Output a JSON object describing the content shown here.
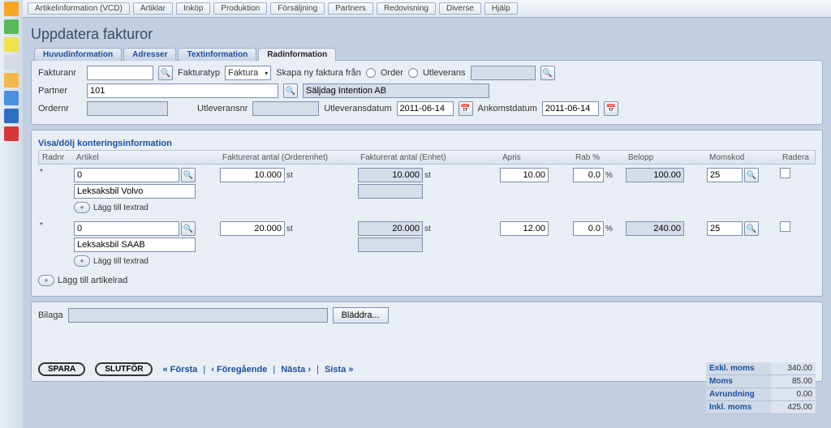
{
  "topmenu": {
    "items": [
      "Artikelinformation (VCD)",
      "Artiklar",
      "Inköp",
      "Produktion",
      "Försäljning",
      "Partners",
      "Redovisning",
      "Diverse",
      "Hjälp"
    ]
  },
  "page": {
    "title": "Uppdatera fakturor"
  },
  "tabs": [
    "Huvudinformation",
    "Adresser",
    "Textinformation",
    "Radinformation"
  ],
  "activeTab": 3,
  "header": {
    "labels": {
      "fakturanr": "Fakturanr",
      "fakturatyp": "Fakturatyp",
      "skapaNyFaktura": "Skapa ny faktura från",
      "order": "Order",
      "utleverans": "Utleverans",
      "partner": "Partner",
      "ordernr": "Ordernr",
      "utleveransnr": "Utleveransnr",
      "utleveransdatum": "Utleveransdatum",
      "ankomstdatum": "Ankomstdatum"
    },
    "values": {
      "fakturanr": "",
      "fakturatyp": "Faktura",
      "partner": "101",
      "partnerName": "Säljdag Intention AB",
      "ordernr": "",
      "utleveransnr": "",
      "utleveransdatum": "2011-06-14",
      "ankomstdatum": "2011-06-14",
      "sourceRef": ""
    }
  },
  "grid": {
    "sectionTitle": "Visa/dölj konteringsinformation",
    "columns": [
      "Radnr",
      "Artikel",
      "Fakturerat antal (Orderenhet)",
      "Fakturerat antal (Enhet)",
      "Ápris",
      "Rab %",
      "Belopp",
      "Momskod",
      "Radera"
    ],
    "rows": [
      {
        "radnr": "*",
        "artikel": "0",
        "artikelDesc": "Leksaksbil Volvo",
        "qtyOrder": "10.000",
        "qtyOrderUnit": "st",
        "qtyUnit": "10.000",
        "qtyUnitUnit": "st",
        "apris": "10.00",
        "rab": "0.0",
        "rabUnit": "%",
        "belopp": "100.00",
        "momskod": "25",
        "addTextLabel": "Lägg till textrad"
      },
      {
        "radnr": "*",
        "artikel": "0",
        "artikelDesc": "Leksaksbil SAAB",
        "qtyOrder": "20.000",
        "qtyOrderUnit": "st",
        "qtyUnit": "20.000",
        "qtyUnitUnit": "st",
        "apris": "12.00",
        "rab": "0.0",
        "rabUnit": "%",
        "belopp": "240.00",
        "momskod": "25",
        "addTextLabel": "Lägg till textrad"
      }
    ],
    "addArticleLabel": "Lägg till artikelrad"
  },
  "attachment": {
    "label": "Bilaga",
    "value": "",
    "browse": "Bläddra..."
  },
  "totals": {
    "rows": [
      {
        "label": "Exkl. moms",
        "value": "340.00"
      },
      {
        "label": "Moms",
        "value": "85.00"
      },
      {
        "label": "Avrundning",
        "value": "0.00"
      },
      {
        "label": "Inkl. moms",
        "value": "425.00"
      }
    ]
  },
  "footer": {
    "save": "SPARA",
    "finish": "SLUTFÖR",
    "nav": {
      "first": "« Första",
      "prev": "‹ Föregående",
      "next": "Nästa ›",
      "last": "Sista »",
      "sep": "|"
    }
  },
  "icons": {
    "search": "🔍",
    "calendar": "📅",
    "plus": "+"
  }
}
